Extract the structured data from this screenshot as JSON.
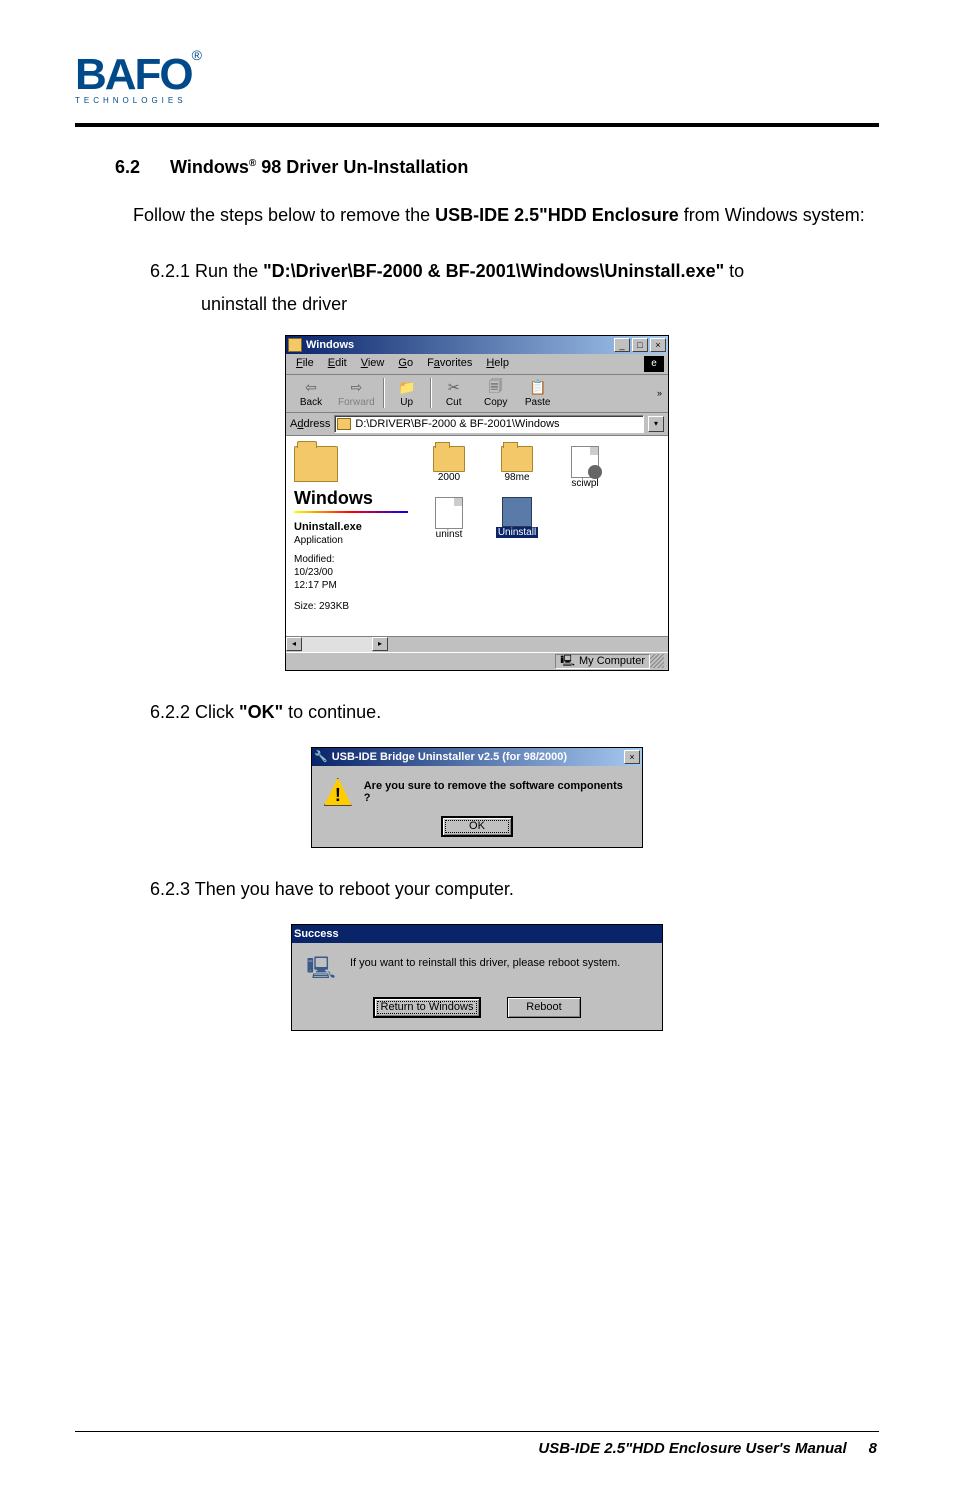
{
  "logo": {
    "text": "BAFO",
    "subtext": "TECHNOLOGIES"
  },
  "section": {
    "number": "6.2",
    "titlePrefix": "Windows",
    "sup": "®",
    "titleSuffix": " 98 Driver Un-Installation"
  },
  "intro": {
    "pre": "Follow the steps below to remove the ",
    "bold": "USB-IDE 2.5\"HDD Enclosure",
    "post": " from Windows system:"
  },
  "step1": {
    "num": "6.2.1",
    "pre": "  Run the ",
    "bold": "\"D:\\Driver\\BF-2000 & BF-2001\\Windows\\Uninstall.exe\"",
    "post": " to",
    "line2": "uninstall the driver"
  },
  "step2": {
    "num": "6.2.2",
    "pre": "  Click ",
    "bold": "\"OK\"",
    "post": " to continue."
  },
  "step3": {
    "num": "6.2.3",
    "text": "  Then you have to reboot your computer."
  },
  "explorer": {
    "title": "Windows",
    "menus": {
      "file": "File",
      "edit": "Edit",
      "view": "View",
      "go": "Go",
      "favorites": "Favorites",
      "help": "Help"
    },
    "toolbar": {
      "back": "Back",
      "forward": "Forward",
      "up": "Up",
      "cut": "Cut",
      "copy": "Copy",
      "paste": "Paste"
    },
    "addrLabel": "Address",
    "addrValue": "D:\\DRIVER\\BF-2000 & BF-2001\\Windows",
    "leftTitle": "Windows",
    "selName": "Uninstall.exe",
    "selType": "Application",
    "metaLabel": "Modified:",
    "metaDate": "10/23/00",
    "metaTime": "12:17 PM",
    "size": "Size: 293KB",
    "items": {
      "i0": "2000",
      "i1": "98me",
      "i2": "sciwpl",
      "i3": "uninst",
      "i4": "Uninstall"
    },
    "status": "My Computer"
  },
  "dlg1": {
    "title": "USB-IDE Bridge Uninstaller v2.5 (for 98/2000)",
    "msg": "Are you sure to remove the software components ?",
    "ok": "OK"
  },
  "dlg2": {
    "title": "Success",
    "msg": "If you want to reinstall this driver, please reboot system.",
    "btn1": "Return to Windows",
    "btn2": "Reboot"
  },
  "footer": {
    "text": "USB-IDE 2.5\"HDD Enclosure User's Manual",
    "page": "8"
  }
}
